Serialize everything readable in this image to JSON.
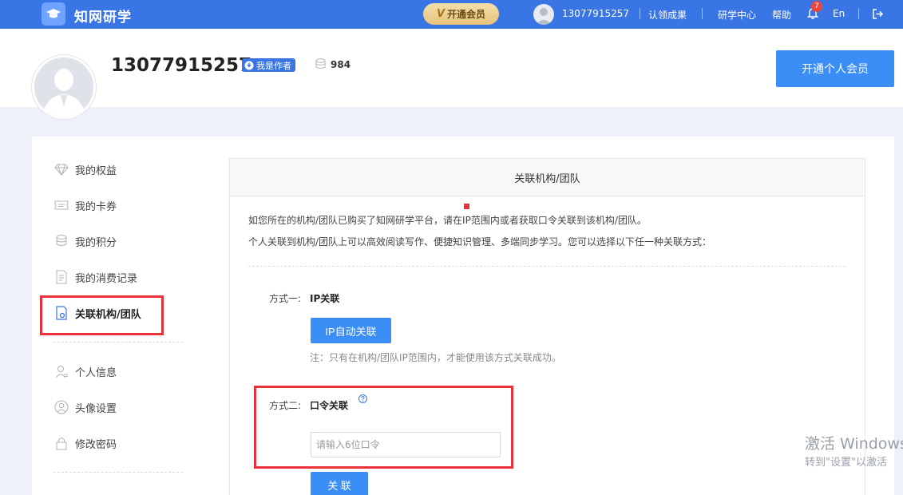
{
  "topbar": {
    "brand": "知网研学",
    "vip_button": "开通会员",
    "vip_mark": "V",
    "phone": "13077915257",
    "links": [
      "认领成果",
      "研学中心",
      "帮助"
    ],
    "notification_count": "7",
    "language": "En"
  },
  "profile": {
    "name": "13077915257",
    "author_badge": "我是作者",
    "points": "984",
    "personal_vip_button": "开通个人会员"
  },
  "sidebar": {
    "items": [
      "我的权益",
      "我的卡券",
      "我的积分",
      "我的消费记录",
      "关联机构/团队",
      "个人信息",
      "头像设置",
      "修改密码"
    ]
  },
  "panel": {
    "title": "关联机构/团队",
    "intro_1": "如您所在的机构/团队已购买了知网研学平台，请在IP范围内或者获取口令关联到该机构/团队。",
    "intro_2": "个人关联到机构/团队上可以高效阅读写作、便捷知识管理、多端同步学习。您可以选择以下任一种关联方式：",
    "method1_label": "方式一:",
    "method1_title": "IP关联",
    "ip_button": "IP自动关联",
    "method1_note": "注：只有在机构/团队IP范围内，才能使用该方式关联成功。",
    "method2_label": "方式二:",
    "method2_title": "口令关联",
    "code_placeholder": "请输入6位口令",
    "link_button": "关 联"
  },
  "watermark": {
    "line1": "激活 Windows",
    "line2": "转到\"设置\"以激活"
  },
  "colors": {
    "primary": "#3a75e6",
    "button": "#3a8ef5",
    "highlight": "#e8313a"
  }
}
